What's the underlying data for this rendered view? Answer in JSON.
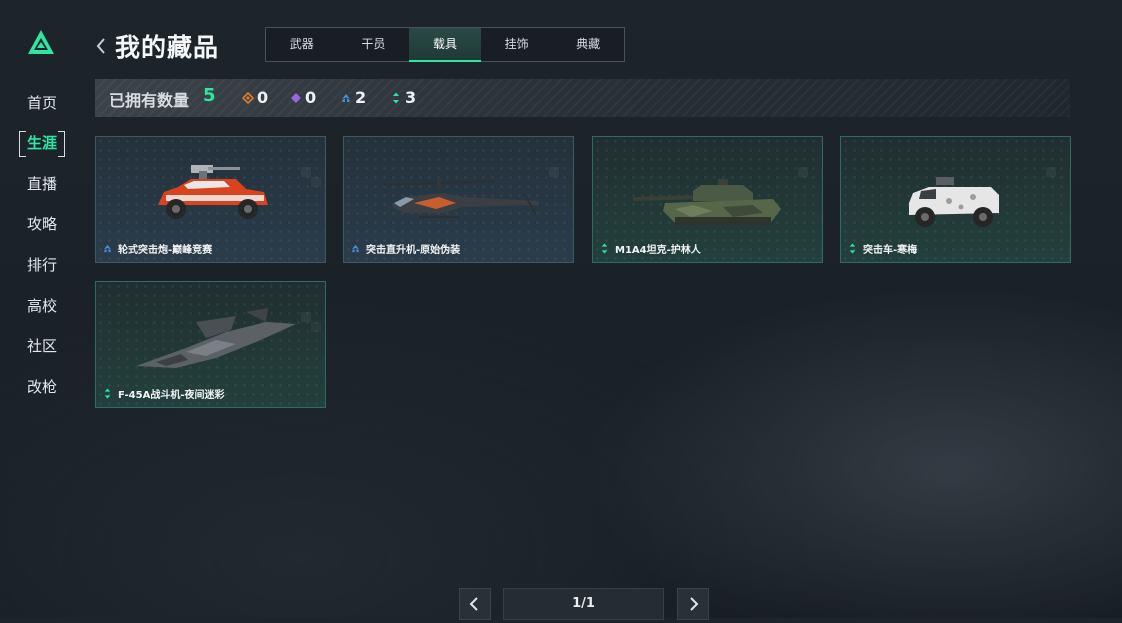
{
  "nav": {
    "items": [
      {
        "label": "首页",
        "active": false
      },
      {
        "label": "生涯",
        "active": true
      },
      {
        "label": "直播",
        "active": false
      },
      {
        "label": "攻略",
        "active": false
      },
      {
        "label": "排行",
        "active": false
      },
      {
        "label": "高校",
        "active": false
      },
      {
        "label": "社区",
        "active": false
      },
      {
        "label": "改枪",
        "active": false
      }
    ]
  },
  "header": {
    "title": "我的藏品"
  },
  "tabs": [
    {
      "label": "武器",
      "active": false
    },
    {
      "label": "干员",
      "active": false
    },
    {
      "label": "载具",
      "active": true
    },
    {
      "label": "挂饰",
      "active": false
    },
    {
      "label": "典藏",
      "active": false
    }
  ],
  "stats": {
    "owned_label": "已拥有数量",
    "owned_count": "5",
    "rarities": [
      {
        "icon": "orange-diamond-icon",
        "color": "#e07a2e",
        "count": "0"
      },
      {
        "icon": "purple-diamond-icon",
        "color": "#9a66e0",
        "count": "0"
      },
      {
        "icon": "blue-chevron-icon",
        "color": "#4a90d9",
        "count": "2"
      },
      {
        "icon": "green-arrows-icon",
        "color": "#2ee6a0",
        "count": "3"
      }
    ]
  },
  "items": [
    {
      "name": "轮式突击炮-巅峰竞赛",
      "rarity": "blue",
      "vehicle": "wheeled-assault-gun"
    },
    {
      "name": "突击直升机-原始伪装",
      "rarity": "blue",
      "vehicle": "attack-helicopter"
    },
    {
      "name": "M1A4坦克-护林人",
      "rarity": "green",
      "vehicle": "tank"
    },
    {
      "name": "突击车-寒梅",
      "rarity": "green",
      "vehicle": "assault-car"
    },
    {
      "name": "F-45A战斗机-夜间迷彩",
      "rarity": "green",
      "vehicle": "fighter-jet"
    }
  ],
  "pagination": {
    "page_text": "1/1"
  },
  "colors": {
    "accent": "#2ee6a0",
    "blue_rarity": "#4a90d9",
    "green_rarity": "#2ee6a0"
  }
}
